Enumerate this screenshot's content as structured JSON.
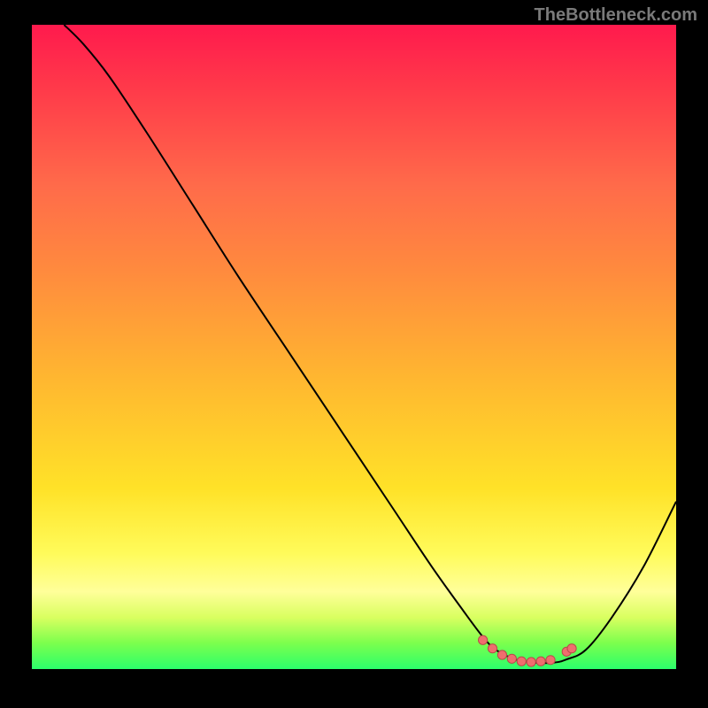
{
  "attribution": "TheBottleneck.com",
  "chart_data": {
    "type": "line",
    "title": "",
    "xlabel": "",
    "ylabel": "",
    "xlim": [
      0,
      100
    ],
    "ylim": [
      0,
      100
    ],
    "series": [
      {
        "name": "bottleneck-curve",
        "x": [
          5,
          8,
          12,
          18,
          25,
          32,
          40,
          48,
          56,
          62,
          67,
          70,
          72,
          75,
          78,
          81,
          83,
          86,
          90,
          95,
          100
        ],
        "y": [
          100,
          97,
          92,
          83,
          72,
          61,
          49,
          37,
          25,
          16,
          9,
          5,
          3,
          1.5,
          1,
          1,
          1.5,
          3,
          8,
          16,
          26
        ]
      }
    ],
    "markers": {
      "name": "optimal-range",
      "x": [
        70,
        71.5,
        73,
        74.5,
        76,
        77.5,
        79,
        80.5,
        83,
        83.8
      ],
      "y": [
        4.5,
        3.2,
        2.2,
        1.6,
        1.2,
        1.1,
        1.2,
        1.4,
        2.7,
        3.2
      ]
    }
  }
}
